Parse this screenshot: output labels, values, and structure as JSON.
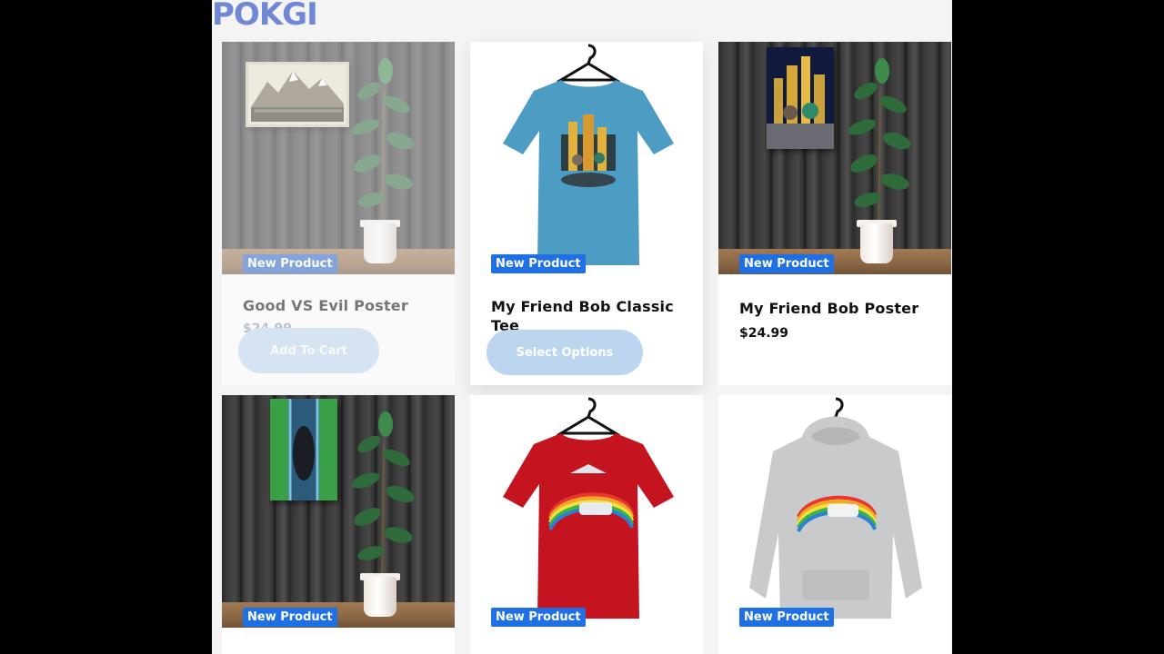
{
  "brand": {
    "logo": "POKGI"
  },
  "colors": {
    "accent": "#1f6fe5",
    "logo": "#6f87d6",
    "cta": "#bcd6f0"
  },
  "products": [
    {
      "badge": "New Product",
      "title": "Good VS Evil Poster",
      "price": "$24.99",
      "cta": "Add To Cart",
      "image": "mountain-poster-on-wood-wall"
    },
    {
      "badge": "New Product",
      "title": "My Friend Bob Classic Tee",
      "price": "",
      "cta": "Select Options",
      "image": "blue-tshirt-on-hanger"
    },
    {
      "badge": "New Product",
      "title": "My Friend Bob Poster",
      "price": "$24.99",
      "cta": "",
      "image": "city-poster-on-wood-wall"
    },
    {
      "badge": "New Product",
      "title": "",
      "price": "",
      "cta": "",
      "image": "waterfall-poster-on-wood-wall"
    },
    {
      "badge": "New Product",
      "title": "",
      "price": "",
      "cta": "",
      "image": "red-tshirt-on-hanger"
    },
    {
      "badge": "New Product",
      "title": "",
      "price": "",
      "cta": "",
      "image": "grey-hoodie-on-hanger"
    }
  ]
}
